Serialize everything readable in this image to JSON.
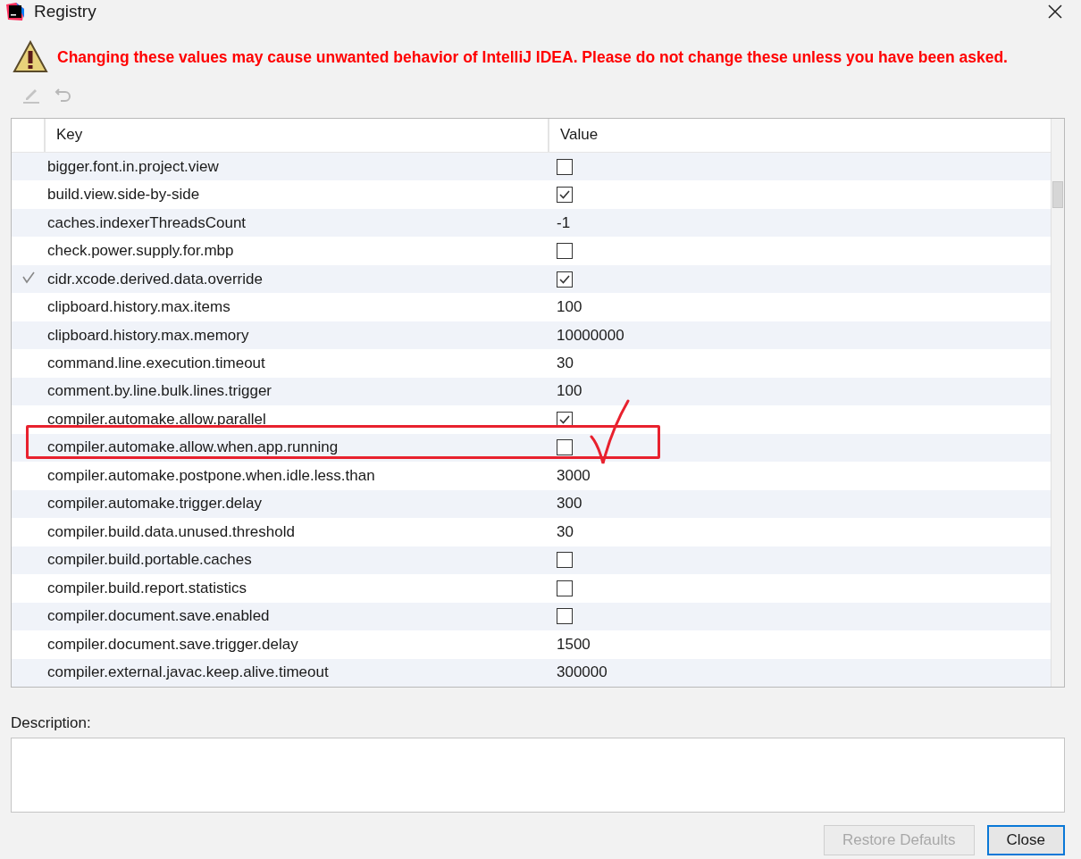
{
  "window": {
    "title": "Registry"
  },
  "warning": "Changing these values may cause unwanted behavior of IntelliJ IDEA. Please do not change these unless you have been asked.",
  "table": {
    "columns": [
      "Key",
      "Value"
    ],
    "rows": [
      {
        "key": "bigger.font.in.project.view",
        "kind": "checkbox",
        "checked": false,
        "modified": false
      },
      {
        "key": "build.view.side-by-side",
        "kind": "checkbox",
        "checked": true,
        "modified": false
      },
      {
        "key": "caches.indexerThreadsCount",
        "kind": "text",
        "value": "-1",
        "modified": false
      },
      {
        "key": "check.power.supply.for.mbp",
        "kind": "checkbox",
        "checked": false,
        "modified": false
      },
      {
        "key": "cidr.xcode.derived.data.override",
        "kind": "checkbox",
        "checked": true,
        "modified": true
      },
      {
        "key": "clipboard.history.max.items",
        "kind": "text",
        "value": "100",
        "modified": false
      },
      {
        "key": "clipboard.history.max.memory",
        "kind": "text",
        "value": "10000000",
        "modified": false
      },
      {
        "key": "command.line.execution.timeout",
        "kind": "text",
        "value": "30",
        "modified": false
      },
      {
        "key": "comment.by.line.bulk.lines.trigger",
        "kind": "text",
        "value": "100",
        "modified": false
      },
      {
        "key": "compiler.automake.allow.parallel",
        "kind": "checkbox",
        "checked": true,
        "modified": false
      },
      {
        "key": "compiler.automake.allow.when.app.running",
        "kind": "checkbox",
        "checked": false,
        "modified": false
      },
      {
        "key": "compiler.automake.postpone.when.idle.less.than",
        "kind": "text",
        "value": "3000",
        "modified": false
      },
      {
        "key": "compiler.automake.trigger.delay",
        "kind": "text",
        "value": "300",
        "modified": false
      },
      {
        "key": "compiler.build.data.unused.threshold",
        "kind": "text",
        "value": "30",
        "modified": false
      },
      {
        "key": "compiler.build.portable.caches",
        "kind": "checkbox",
        "checked": false,
        "modified": false
      },
      {
        "key": "compiler.build.report.statistics",
        "kind": "checkbox",
        "checked": false,
        "modified": false
      },
      {
        "key": "compiler.document.save.enabled",
        "kind": "checkbox",
        "checked": false,
        "modified": false
      },
      {
        "key": "compiler.document.save.trigger.delay",
        "kind": "text",
        "value": "1500",
        "modified": false
      },
      {
        "key": "compiler.external.javac.keep.alive.timeout",
        "kind": "text",
        "value": "300000",
        "modified": false
      }
    ]
  },
  "description": {
    "label": "Description:"
  },
  "buttons": [
    {
      "label": "Restore Defaults",
      "disabled": true,
      "focused": false
    },
    {
      "label": "Close",
      "disabled": false,
      "focused": true
    }
  ]
}
